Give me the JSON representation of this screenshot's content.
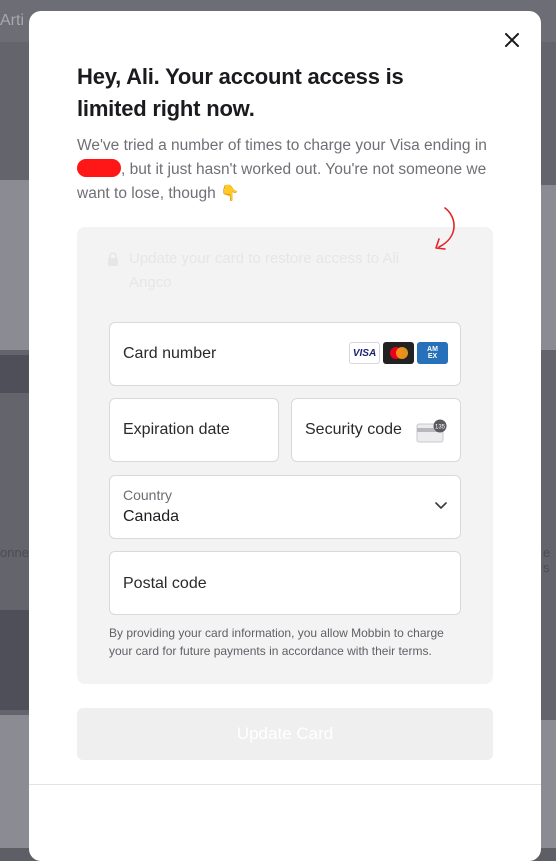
{
  "background": {
    "title_fragment": "Arti",
    "side_text_left": "onne",
    "side_text_right": "e s"
  },
  "modal": {
    "heading": "Hey, Ali. Your account access is limited right now.",
    "description_before": "We've tried a number of times to charge your Visa ending in",
    "description_after": ", but it just hasn't worked out. You're not someone we want to lose, though 👇",
    "notice": "Update your card to restore access to Ali Angco",
    "card_number_label": "Card number",
    "card_brands": [
      "VISA",
      "Mastercard",
      "AMEX"
    ],
    "expiration_label": "Expiration date",
    "security_label": "Security code",
    "country_label": "Country",
    "country_value": "Canada",
    "postal_label": "Postal code",
    "terms": "By providing your card information, you allow Mobbin to charge your card for future payments in accordance with their terms.",
    "update_button": "Update Card",
    "cvc_icon_text": "135"
  },
  "colors": {
    "redaction": "#ff1717",
    "arrow": "#e0242a",
    "overlay": "#63646c"
  }
}
